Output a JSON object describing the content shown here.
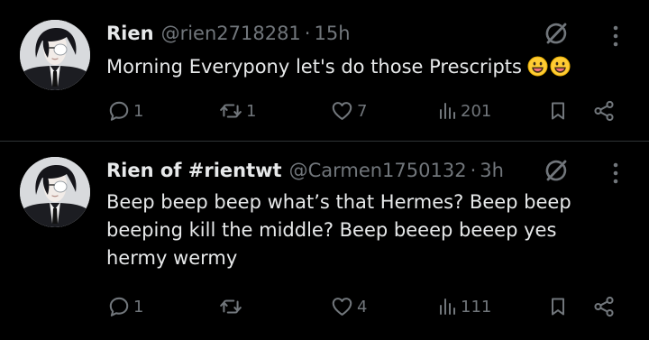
{
  "tweets": [
    {
      "display_name": "Rien",
      "handle": "@rien2718281",
      "separator": "·",
      "time": "15h",
      "text": "Morning Everypony let's do those Prescripts",
      "emojis": [
        "grinning-face-emoji",
        "grinning-face-emoji"
      ],
      "replies": "1",
      "reposts": "1",
      "likes": "7",
      "views": "201"
    },
    {
      "display_name": "Rien of #rientwt",
      "handle": "@Carmen1750132",
      "separator": "·",
      "time": "3h",
      "text": "Beep beep beep what’s that Hermes? Beep beep\nbeeping kill the middle? Beep beeep beeep yes\nhermy wermy",
      "emojis": [],
      "replies": "1",
      "reposts": "",
      "likes": "4",
      "views": "111"
    }
  ],
  "icons": {
    "reply": "reply-bubble-icon",
    "repost": "repost-arrows-icon",
    "like": "heart-icon",
    "views": "views-bar-chart-icon",
    "bookmark": "bookmark-icon",
    "share": "share-icon",
    "grok": "grok-slash-icon",
    "more": "more-vertical-dots-icon"
  },
  "colors": {
    "background": "#000000",
    "text": "#e7e9ea",
    "secondary": "#71767b",
    "divider": "#2f3336",
    "emoji": "#ffcc33"
  }
}
